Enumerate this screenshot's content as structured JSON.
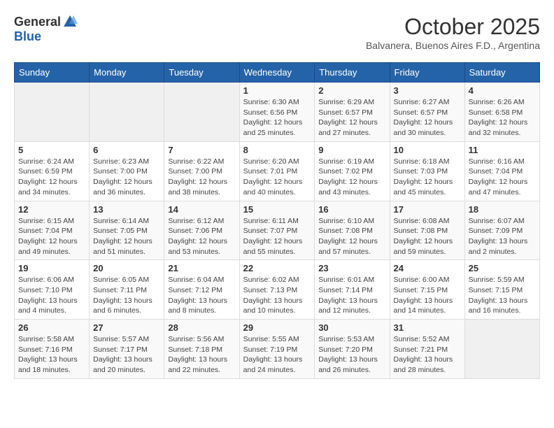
{
  "logo": {
    "general": "General",
    "blue": "Blue"
  },
  "title": "October 2025",
  "subtitle": "Balvanera, Buenos Aires F.D., Argentina",
  "weekdays": [
    "Sunday",
    "Monday",
    "Tuesday",
    "Wednesday",
    "Thursday",
    "Friday",
    "Saturday"
  ],
  "weeks": [
    [
      {
        "day": "",
        "sunrise": "",
        "sunset": "",
        "daylight": ""
      },
      {
        "day": "",
        "sunrise": "",
        "sunset": "",
        "daylight": ""
      },
      {
        "day": "",
        "sunrise": "",
        "sunset": "",
        "daylight": ""
      },
      {
        "day": "1",
        "sunrise": "Sunrise: 6:30 AM",
        "sunset": "Sunset: 6:56 PM",
        "daylight": "Daylight: 12 hours and 25 minutes."
      },
      {
        "day": "2",
        "sunrise": "Sunrise: 6:29 AM",
        "sunset": "Sunset: 6:57 PM",
        "daylight": "Daylight: 12 hours and 27 minutes."
      },
      {
        "day": "3",
        "sunrise": "Sunrise: 6:27 AM",
        "sunset": "Sunset: 6:57 PM",
        "daylight": "Daylight: 12 hours and 30 minutes."
      },
      {
        "day": "4",
        "sunrise": "Sunrise: 6:26 AM",
        "sunset": "Sunset: 6:58 PM",
        "daylight": "Daylight: 12 hours and 32 minutes."
      }
    ],
    [
      {
        "day": "5",
        "sunrise": "Sunrise: 6:24 AM",
        "sunset": "Sunset: 6:59 PM",
        "daylight": "Daylight: 12 hours and 34 minutes."
      },
      {
        "day": "6",
        "sunrise": "Sunrise: 6:23 AM",
        "sunset": "Sunset: 7:00 PM",
        "daylight": "Daylight: 12 hours and 36 minutes."
      },
      {
        "day": "7",
        "sunrise": "Sunrise: 6:22 AM",
        "sunset": "Sunset: 7:00 PM",
        "daylight": "Daylight: 12 hours and 38 minutes."
      },
      {
        "day": "8",
        "sunrise": "Sunrise: 6:20 AM",
        "sunset": "Sunset: 7:01 PM",
        "daylight": "Daylight: 12 hours and 40 minutes."
      },
      {
        "day": "9",
        "sunrise": "Sunrise: 6:19 AM",
        "sunset": "Sunset: 7:02 PM",
        "daylight": "Daylight: 12 hours and 43 minutes."
      },
      {
        "day": "10",
        "sunrise": "Sunrise: 6:18 AM",
        "sunset": "Sunset: 7:03 PM",
        "daylight": "Daylight: 12 hours and 45 minutes."
      },
      {
        "day": "11",
        "sunrise": "Sunrise: 6:16 AM",
        "sunset": "Sunset: 7:04 PM",
        "daylight": "Daylight: 12 hours and 47 minutes."
      }
    ],
    [
      {
        "day": "12",
        "sunrise": "Sunrise: 6:15 AM",
        "sunset": "Sunset: 7:04 PM",
        "daylight": "Daylight: 12 hours and 49 minutes."
      },
      {
        "day": "13",
        "sunrise": "Sunrise: 6:14 AM",
        "sunset": "Sunset: 7:05 PM",
        "daylight": "Daylight: 12 hours and 51 minutes."
      },
      {
        "day": "14",
        "sunrise": "Sunrise: 6:12 AM",
        "sunset": "Sunset: 7:06 PM",
        "daylight": "Daylight: 12 hours and 53 minutes."
      },
      {
        "day": "15",
        "sunrise": "Sunrise: 6:11 AM",
        "sunset": "Sunset: 7:07 PM",
        "daylight": "Daylight: 12 hours and 55 minutes."
      },
      {
        "day": "16",
        "sunrise": "Sunrise: 6:10 AM",
        "sunset": "Sunset: 7:08 PM",
        "daylight": "Daylight: 12 hours and 57 minutes."
      },
      {
        "day": "17",
        "sunrise": "Sunrise: 6:08 AM",
        "sunset": "Sunset: 7:08 PM",
        "daylight": "Daylight: 12 hours and 59 minutes."
      },
      {
        "day": "18",
        "sunrise": "Sunrise: 6:07 AM",
        "sunset": "Sunset: 7:09 PM",
        "daylight": "Daylight: 13 hours and 2 minutes."
      }
    ],
    [
      {
        "day": "19",
        "sunrise": "Sunrise: 6:06 AM",
        "sunset": "Sunset: 7:10 PM",
        "daylight": "Daylight: 13 hours and 4 minutes."
      },
      {
        "day": "20",
        "sunrise": "Sunrise: 6:05 AM",
        "sunset": "Sunset: 7:11 PM",
        "daylight": "Daylight: 13 hours and 6 minutes."
      },
      {
        "day": "21",
        "sunrise": "Sunrise: 6:04 AM",
        "sunset": "Sunset: 7:12 PM",
        "daylight": "Daylight: 13 hours and 8 minutes."
      },
      {
        "day": "22",
        "sunrise": "Sunrise: 6:02 AM",
        "sunset": "Sunset: 7:13 PM",
        "daylight": "Daylight: 13 hours and 10 minutes."
      },
      {
        "day": "23",
        "sunrise": "Sunrise: 6:01 AM",
        "sunset": "Sunset: 7:14 PM",
        "daylight": "Daylight: 13 hours and 12 minutes."
      },
      {
        "day": "24",
        "sunrise": "Sunrise: 6:00 AM",
        "sunset": "Sunset: 7:15 PM",
        "daylight": "Daylight: 13 hours and 14 minutes."
      },
      {
        "day": "25",
        "sunrise": "Sunrise: 5:59 AM",
        "sunset": "Sunset: 7:15 PM",
        "daylight": "Daylight: 13 hours and 16 minutes."
      }
    ],
    [
      {
        "day": "26",
        "sunrise": "Sunrise: 5:58 AM",
        "sunset": "Sunset: 7:16 PM",
        "daylight": "Daylight: 13 hours and 18 minutes."
      },
      {
        "day": "27",
        "sunrise": "Sunrise: 5:57 AM",
        "sunset": "Sunset: 7:17 PM",
        "daylight": "Daylight: 13 hours and 20 minutes."
      },
      {
        "day": "28",
        "sunrise": "Sunrise: 5:56 AM",
        "sunset": "Sunset: 7:18 PM",
        "daylight": "Daylight: 13 hours and 22 minutes."
      },
      {
        "day": "29",
        "sunrise": "Sunrise: 5:55 AM",
        "sunset": "Sunset: 7:19 PM",
        "daylight": "Daylight: 13 hours and 24 minutes."
      },
      {
        "day": "30",
        "sunrise": "Sunrise: 5:53 AM",
        "sunset": "Sunset: 7:20 PM",
        "daylight": "Daylight: 13 hours and 26 minutes."
      },
      {
        "day": "31",
        "sunrise": "Sunrise: 5:52 AM",
        "sunset": "Sunset: 7:21 PM",
        "daylight": "Daylight: 13 hours and 28 minutes."
      },
      {
        "day": "",
        "sunrise": "",
        "sunset": "",
        "daylight": ""
      }
    ]
  ]
}
